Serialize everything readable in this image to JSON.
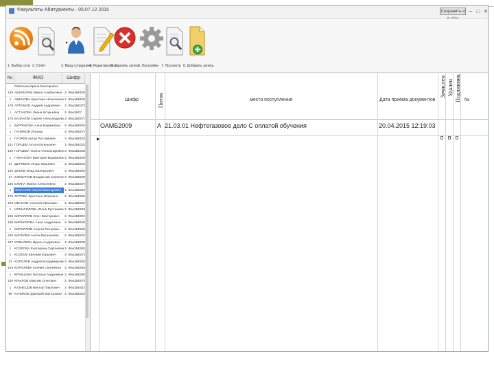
{
  "window": {
    "title": "Факультеты Абитуриенты · 05.07.12 2015",
    "exit_label": "Сохранить и выйти",
    "controls": [
      "–",
      "□",
      "✕"
    ]
  },
  "toolbar": {
    "buttons": [
      {
        "label": "1. Выбор сети",
        "icon": "rss-icon"
      },
      {
        "label": "2. Отчёт",
        "icon": "document-search-icon"
      },
      {
        "label": "3. Ввод сотрудника",
        "icon": "user-icon"
      },
      {
        "label": "4. Редактировать",
        "icon": "edit-document-icon"
      },
      {
        "label": "5. Удалить запись",
        "icon": "delete-icon"
      },
      {
        "label": "6. Настройки",
        "icon": "gear-icon"
      },
      {
        "label": "7. Просмотр",
        "icon": "preview-icon"
      },
      {
        "label": "8. Добавить запись",
        "icon": "add-folder-icon"
      }
    ]
  },
  "left_panel": {
    "headers": [
      "№",
      "ФИО",
      "Шифр"
    ],
    "rows": [
      {
        "n": "",
        "name": "Ребятина Ирина Викторовна",
        "code": ""
      },
      {
        "n": "136",
        "name": "АБИЛЬТИМ Ирина Алибековна",
        "code": "3. Фак1БЕ005"
      },
      {
        "n": "1",
        "name": "АВЕНОВА Кристина Николаевна",
        "code": "3. Фак1БЕ006"
      },
      {
        "n": "176",
        "name": "АРТЕМОВ Андрей Андреевич",
        "code": "3. Фак1БЕ374"
      },
      {
        "n": "1",
        "name": "АСТАХОВА Лиана Игорьевна",
        "code": "3. Фак1Б07"
      },
      {
        "n": "175",
        "name": "БАЗАНОВ Сергей Александрович",
        "code": "3. Фак1БЕ073"
      },
      {
        "n": "1",
        "name": "БУРЛАКОВА Анна Вадимовна",
        "code": "3. Фак1БЕ028"
      },
      {
        "n": "1",
        "name": "ГАЛИМОВ Ильнар",
        "code": "3. Фак1БЕ077"
      },
      {
        "n": "1",
        "name": "ГАЛИЕВ Артур Рустамович",
        "code": "3. Фак1БЕ021"
      },
      {
        "n": "131",
        "name": "ГОРЦЕВ Антон Евгеньевич",
        "code": "3. Фак1БЕ322"
      },
      {
        "n": "139",
        "name": "ГОРЦЕВА Ольга Александровна",
        "code": "3. Фак1БЕ035"
      },
      {
        "n": "1",
        "name": "ГУБАНОВА Виктория Вадимовна",
        "code": "3. Фак1БЕ008"
      },
      {
        "n": "17",
        "name": "ДЕРЯБИН Игорь Юрьевич",
        "code": "3. Фак1БЕ034"
      },
      {
        "n": "136",
        "name": "ДУБОВ Влад Валерьевич",
        "code": "3. Фак1БЕ054"
      },
      {
        "n": "17",
        "name": "ЕЛИЗАРОВ Владислав Сергеевич",
        "code": "3. Фак1БЕ039"
      },
      {
        "n": "136",
        "name": "ЕЛИНА Ирина Алексеевна",
        "code": "3. Фак1БЕ078"
      },
      {
        "n": "1",
        "name": "ЖИГАНОВ Сергей Викторович",
        "code": "3. Фак1БЕ029",
        "selected": true
      },
      {
        "n": "175",
        "name": "ЗОТОВА Кристина Игоревна",
        "code": "3. Фак1БЕ058"
      },
      {
        "n": "133",
        "name": "ИВАНОВ Алексей Иванович",
        "code": "3. Фак1БЕ020"
      },
      {
        "n": "1",
        "name": "ИСМАГИЛОВА Юлия Рустамовна",
        "code": "3. Фак1БЕ061"
      },
      {
        "n": "135",
        "name": "КИРИЛЛОВ Олег Викторович",
        "code": "3. Фак1БЕ057"
      },
      {
        "n": "136",
        "name": "КИРИЛЛОВА Анна Андреевна",
        "code": "3. Фак1БЕ045"
      },
      {
        "n": "1",
        "name": "КИРИЛЛОВ Сергей Петрович",
        "code": "3. Фак1БЕ099"
      },
      {
        "n": "130",
        "name": "КИСЕЛЕВ Антон Витальевич",
        "code": "3. Фак1БЕ037"
      },
      {
        "n": "137",
        "name": "КОВАЛЕВА Ирина Андреевна",
        "code": "3. Фак1БЕ039"
      },
      {
        "n": "1",
        "name": "КОЗЛОВА Екатерина Сергеевна",
        "code": "3. Фак1БЕ083"
      },
      {
        "n": "1",
        "name": "КОЗЛОВ Евгений Юрьевич",
        "code": "3. Фак1БЕ071"
      },
      {
        "n": "13",
        "name": "КОРОЛЕВ Андрей Владимирович",
        "code": "3. Фак1БЕ062"
      },
      {
        "n": "134",
        "name": "КОРОЛЕВА Ксения Сергеевна",
        "code": "3. Фак1БЕ059"
      },
      {
        "n": "1",
        "name": "КРАВЦОВА Наталья Андреевна",
        "code": "3. Фак1БЕ085"
      },
      {
        "n": "130",
        "name": "КРЫЛОВ Максим Олегович",
        "code": "3. Фак1БЕ079"
      },
      {
        "n": "1",
        "name": "КУЗНЕЦОВ Виктор Павлович",
        "code": "3. Фак1БЕ014"
      },
      {
        "n": "99",
        "name": "КУЛИКОВ Дмитрий Викторович",
        "code": "3. Фак1БЕ028"
      }
    ]
  },
  "grid": {
    "headers": {
      "code": "Шифр",
      "stream": "Поток",
      "place": "место поступления",
      "date": "Дата приёма документов",
      "col_a": "Зачислен",
      "col_b": "Удален",
      "col_c": "Подлинник",
      "num": "№"
    },
    "rows": [
      {
        "code": "ОАМБ2009",
        "stream": "А",
        "place": "21.03.01 Нефтегазовое дело С оплатой обучения",
        "date": "20.04.2015 12:19:03",
        "indicator": "▶"
      }
    ]
  }
}
